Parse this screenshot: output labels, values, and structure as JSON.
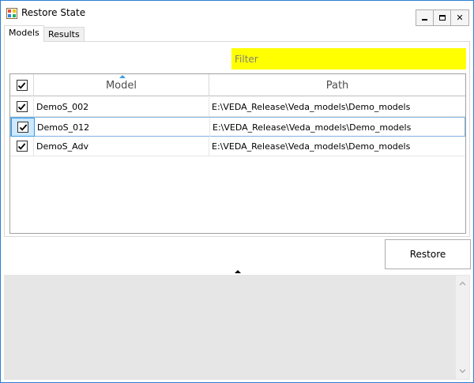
{
  "window": {
    "title": "Restore State",
    "controls": [
      "minimize-icon",
      "maximize-icon",
      "close-icon"
    ],
    "close_glyph": "✕"
  },
  "tabs": [
    {
      "label": "Models",
      "active": true
    },
    {
      "label": "Results",
      "active": false
    }
  ],
  "filter": {
    "placeholder": "Filter",
    "value": "",
    "background": "#ffff00"
  },
  "grid": {
    "columns": [
      "",
      "Model",
      "Path"
    ],
    "sorted_column": "Model",
    "header_checked": true,
    "rows": [
      {
        "checked": true,
        "model": "DemoS_002",
        "path": "E:\\VEDA_Release\\Veda_models\\Demo_models",
        "selected": false
      },
      {
        "checked": true,
        "model": "DemoS_012",
        "path": "E:\\VEDA_Release\\Veda_models\\Demo_models",
        "selected": true
      },
      {
        "checked": true,
        "model": "DemoS_Adv",
        "path": "E:\\VEDA_Release\\Veda_models\\Demo_models",
        "selected": false
      }
    ]
  },
  "restore_button": {
    "label": "Restore"
  },
  "colors": {
    "accent": "#3c9ae0",
    "window_border": "#2b7fd4",
    "log_background": "#e6e6e6"
  }
}
